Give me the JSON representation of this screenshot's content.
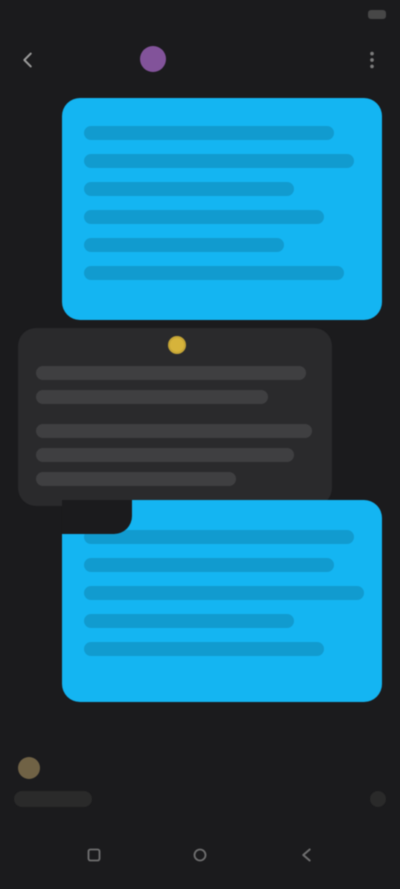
{
  "status_bar": {
    "time": "",
    "right": ""
  },
  "header": {
    "title": "",
    "avatar_color": "#8e5aa8"
  },
  "chat": {
    "messages": [
      {
        "direction": "outgoing",
        "text": ""
      },
      {
        "direction": "incoming",
        "text": ""
      },
      {
        "direction": "outgoing",
        "text": ""
      }
    ]
  },
  "composer": {
    "placeholder": ""
  },
  "nav": {
    "items": [
      {
        "icon": "recent-apps-icon"
      },
      {
        "icon": "home-icon"
      },
      {
        "icon": "back-icon"
      }
    ]
  },
  "theme": {
    "background": "#1b1b1d",
    "outgoing_bubble": "#14b5f2",
    "incoming_bubble": "#2a2a2c"
  }
}
